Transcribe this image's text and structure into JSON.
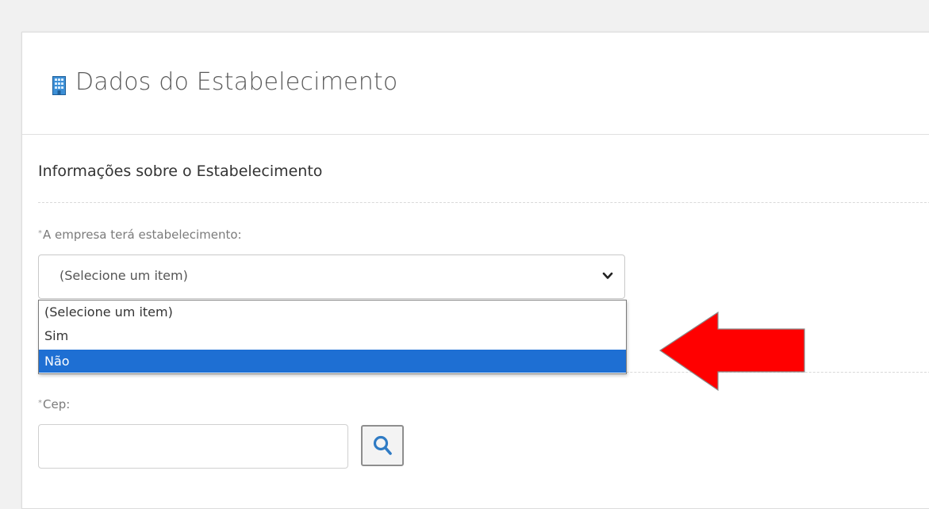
{
  "panel": {
    "title": "Dados do Estabelecimento",
    "title_icon": "building-icon"
  },
  "section": {
    "title": "Informações sobre o Estabelecimento"
  },
  "establishment_field": {
    "required_mark": "*",
    "label": "A empresa terá estabelecimento:",
    "selected_value": "(Selecione um item)",
    "options": [
      "(Selecione um item)",
      "Sim",
      "Não"
    ],
    "highlighted_option": "Não"
  },
  "cep_field": {
    "required_mark": "*",
    "label": "Cep:",
    "value": "",
    "search_icon": "search-icon"
  },
  "colors": {
    "highlight": "#1e6fd3",
    "arrow": "#ff0000",
    "search_icon": "#2f7bc4"
  }
}
